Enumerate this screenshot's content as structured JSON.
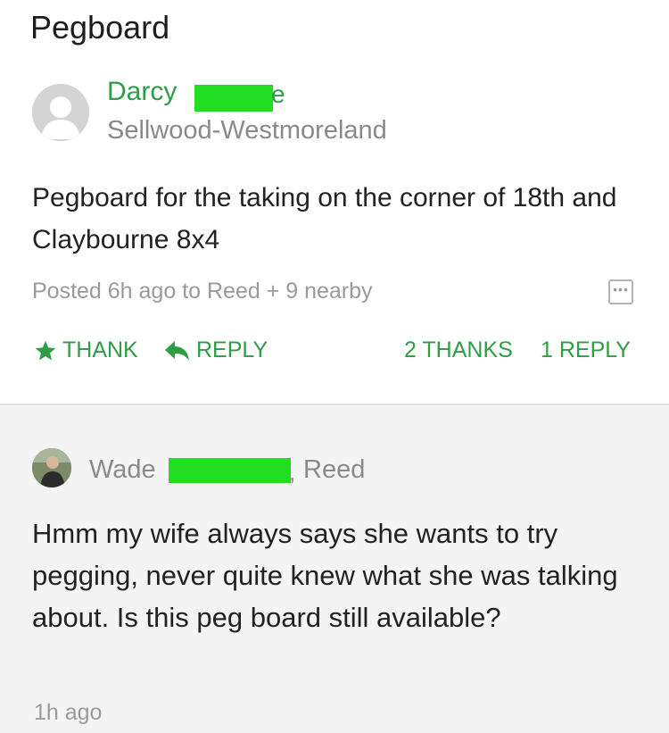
{
  "page_title": "Pegboard",
  "post": {
    "author_name": "Darcy",
    "author_name_tail": "e",
    "neighborhood": "Sellwood-Westmoreland",
    "body": "Pegboard for the taking on the corner of 18th and Claybourne 8x4",
    "meta": "Posted 6h ago to Reed + 9 nearby",
    "more_icon": "ellipsis-icon",
    "actions": {
      "thank_label": "THANK",
      "reply_label": "REPLY",
      "thanks_count": "2 THANKS",
      "replies_count": "1 REPLY"
    }
  },
  "reply": {
    "author_name": "Wade",
    "author_comma": ",",
    "neighborhood": "Reed",
    "body": "Hmm my wife always says she wants to try pegging, never quite knew what she was talking about. Is this peg board still available?",
    "time": "1h ago"
  },
  "colors": {
    "accent": "#2e9e45",
    "redaction": "#22dd22",
    "muted_text": "#8a8a8a",
    "reply_background": "#f4f4f4"
  }
}
